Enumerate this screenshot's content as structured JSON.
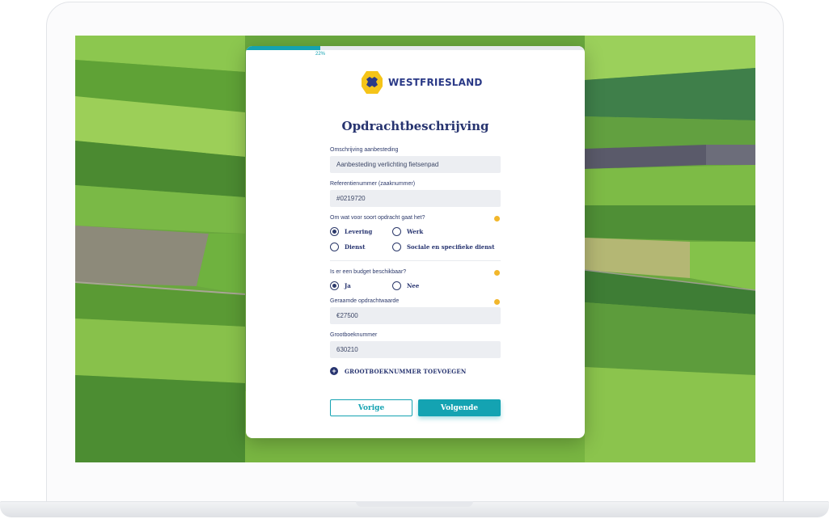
{
  "progress": {
    "percent_label": "22%",
    "fraction": 0.22
  },
  "brand": {
    "name": "WESTFRIESLAND",
    "color": "#2b3a87",
    "shield_color": "#f5c419"
  },
  "form": {
    "title": "Opdrachtbeschrijving",
    "description_field": {
      "label": "Omschrijving aanbesteding",
      "value": "Aanbesteding verlichting fietsenpad"
    },
    "reference_field": {
      "label": "Referentienummer (zaaknummer)",
      "value": "#0219720"
    },
    "assignment_type": {
      "question": "Om wat voor soort opdracht gaat het?",
      "options": [
        "Levering",
        "Werk",
        "Dienst",
        "Sociale en specifieke dienst"
      ],
      "selected": "Levering"
    },
    "budget": {
      "question": "Is er een budget beschikbaar?",
      "options": [
        "Ja",
        "Nee"
      ],
      "selected": "Ja"
    },
    "estimated_value_field": {
      "label": "Geraamde opdrachtwaarde",
      "value": "€27500"
    },
    "ledger_field": {
      "label": "Grootboeknummer",
      "value": "630210"
    },
    "add_ledger_label": "GROOTBOEKNUMMER TOEVOEGEN",
    "prev_button": "Vorige",
    "next_button": "Volgende"
  },
  "colors": {
    "accent": "#14a3b2",
    "navy": "#26336f",
    "info": "#f2b72b",
    "input_bg": "#eceef2"
  }
}
